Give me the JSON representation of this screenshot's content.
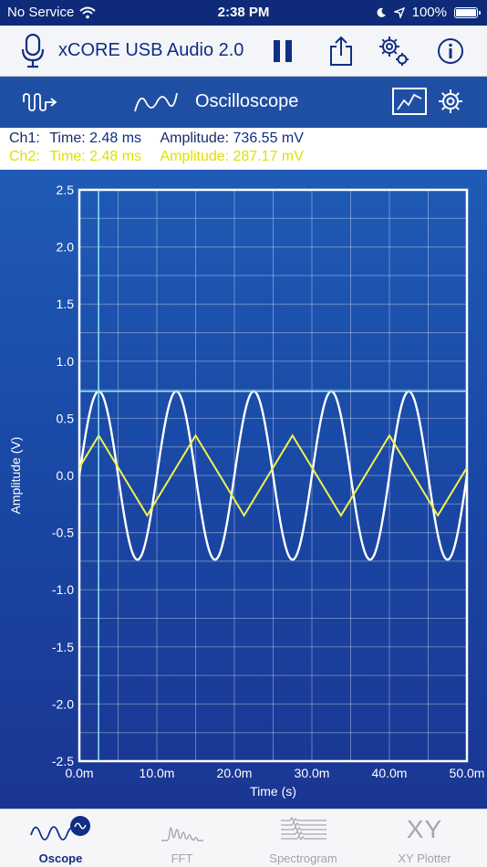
{
  "status_bar": {
    "carrier": "No Service",
    "time": "2:38 PM",
    "battery": "100%"
  },
  "toolbar": {
    "device_title": "xCORE USB Audio 2.0"
  },
  "scope": {
    "title": "Oscilloscope"
  },
  "readout": {
    "ch1": {
      "label": "Ch1:",
      "time_label": "Time:",
      "time": "2.48 ms",
      "amp_label": "Amplitude:",
      "amp": "736.55 mV"
    },
    "ch2": {
      "label": "Ch2:",
      "time_label": "Time:",
      "time": "2.48 ms",
      "amp_label": "Amplitude:",
      "amp": "287.17 mV"
    }
  },
  "chart_data": {
    "type": "line",
    "xlabel": "Time (s)",
    "ylabel": "Amplitude (V)",
    "xlim": [
      0,
      0.05
    ],
    "ylim": [
      -2.5,
      2.5
    ],
    "x_ticks": [
      "0.0m",
      "10.0m",
      "20.0m",
      "30.0m",
      "40.0m",
      "50.0m"
    ],
    "y_ticks": [
      "2.5",
      "2.0",
      "1.5",
      "1.0",
      "0.5",
      "0.0",
      "-0.5",
      "-1.0",
      "-1.5",
      "-2.0",
      "-2.5"
    ],
    "grid": true,
    "cursor": {
      "time": 0.00248,
      "amplitude": 0.73655
    },
    "series": [
      {
        "color": "#ffffff",
        "shape": "sine",
        "amplitude": 0.7366,
        "period": 0.01,
        "phase_peak_time": 0.0025
      },
      {
        "color": "#f2f24a",
        "shape": "triangle",
        "amplitude": 0.35,
        "period": 0.0125,
        "phase_peak_time": 0.0025
      }
    ]
  },
  "tabs": [
    {
      "label": "Oscope",
      "active": true,
      "icon": "oscope-icon"
    },
    {
      "label": "FFT",
      "active": false,
      "icon": "fft-icon"
    },
    {
      "label": "Spectrogram",
      "active": false,
      "icon": "spectrogram-icon"
    },
    {
      "label": "XY Plotter",
      "active": false,
      "icon": "xy-plotter-icon",
      "glyph": "XY"
    }
  ]
}
